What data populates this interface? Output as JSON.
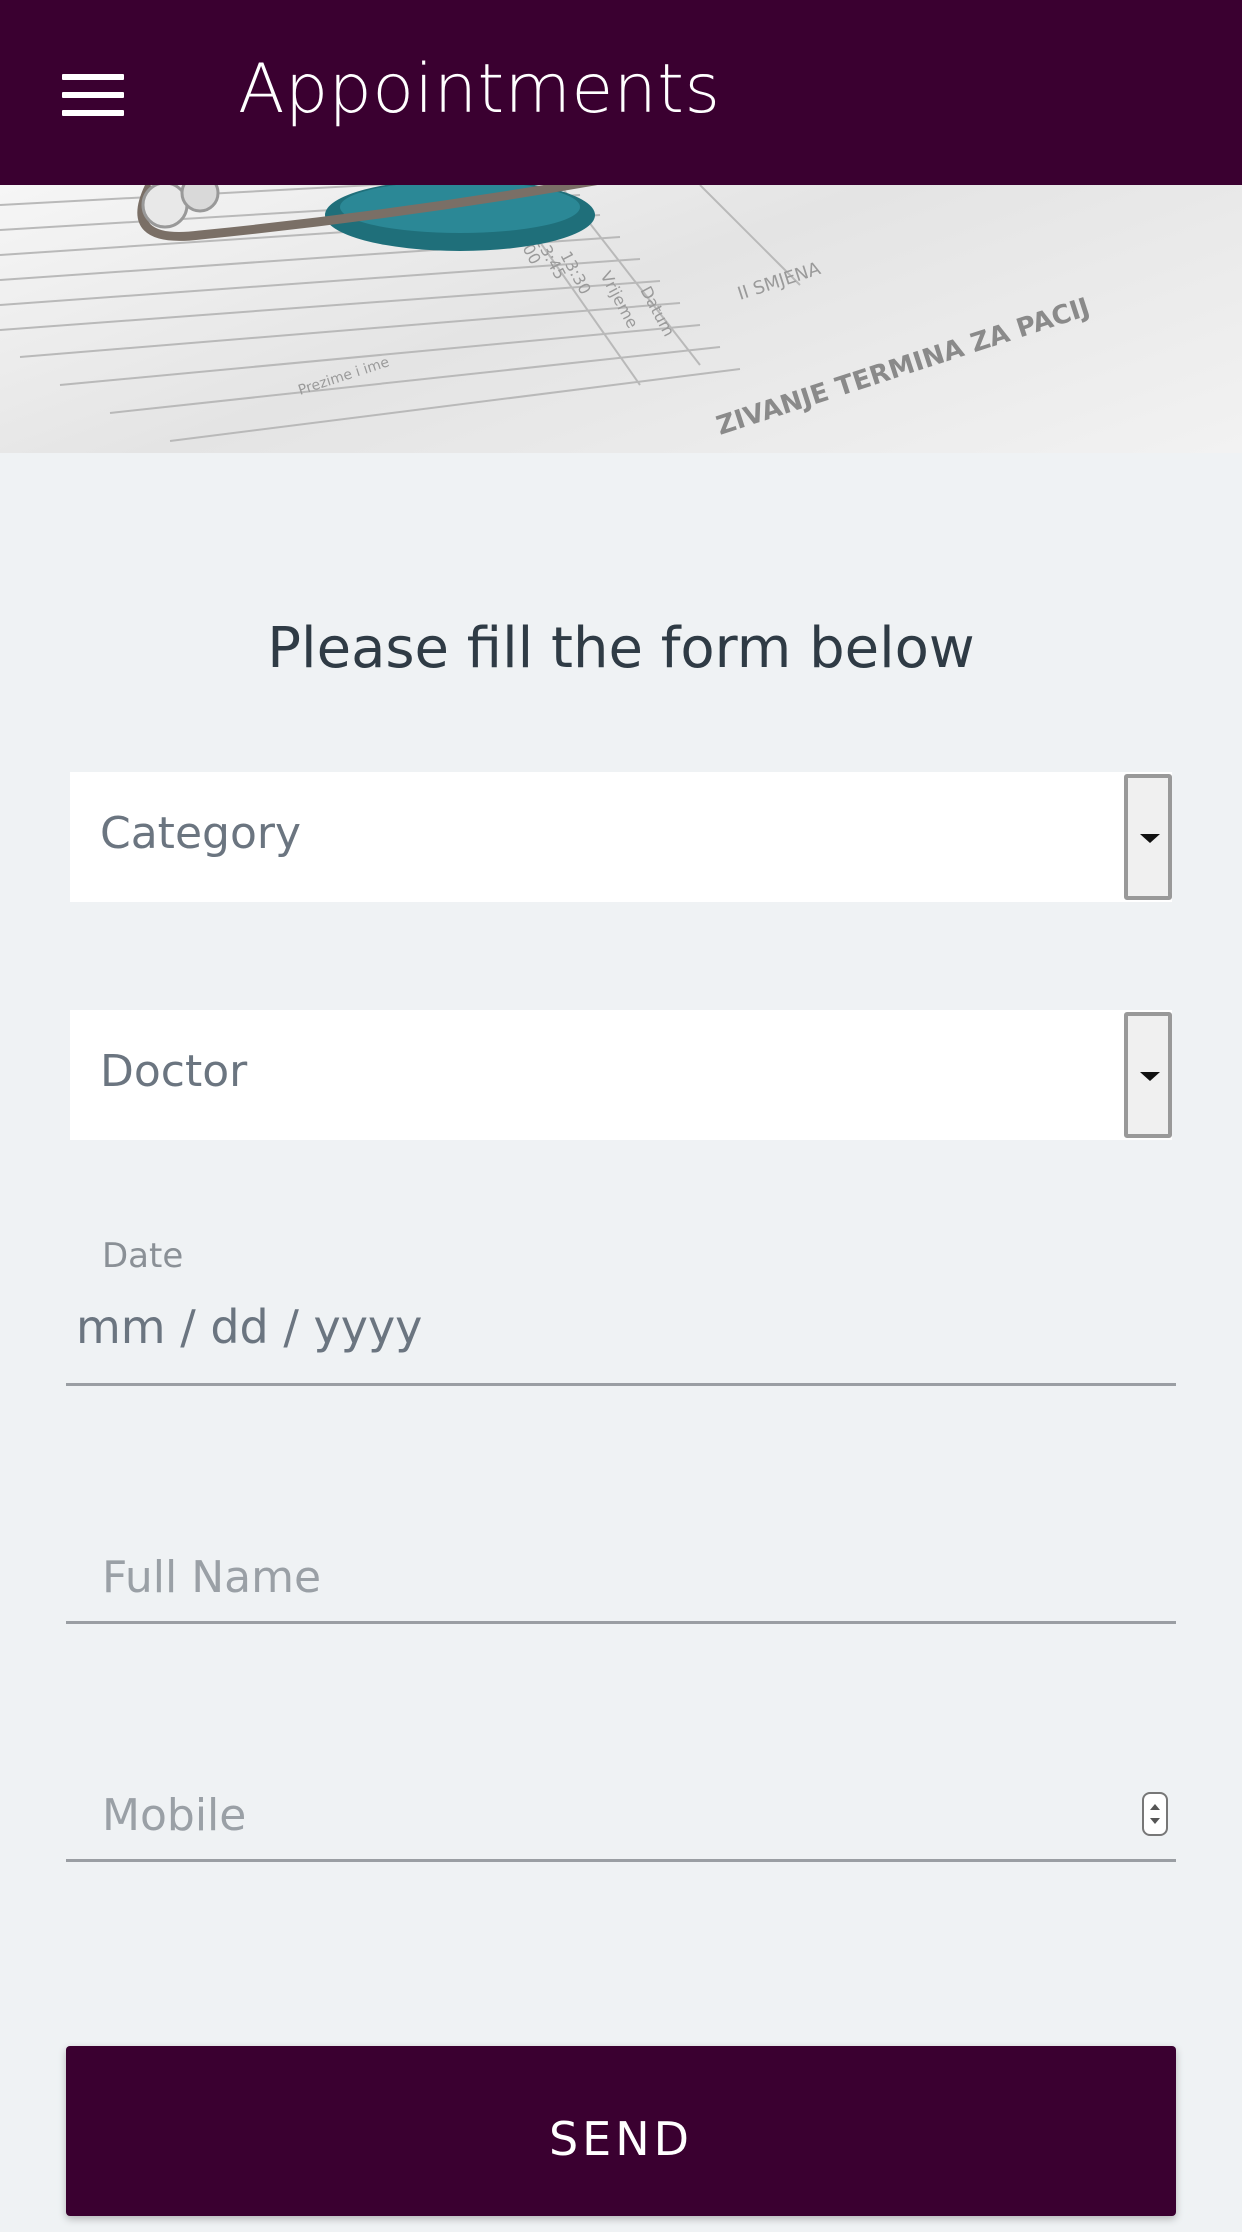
{
  "appbar": {
    "title": "Appointments",
    "menu_icon": "hamburger-menu-icon",
    "background_color": "#3a0030"
  },
  "hero": {
    "image": "stethoscope-on-appointment-form",
    "form_text_lines": [
      "ZIVANJE TERMINA ZA PACIJ",
      "II SMJENA",
      "Datum",
      "Vrijeme",
      "13:30",
      "13:45",
      "14:00",
      "Prezime i ime"
    ]
  },
  "form": {
    "heading": "Please fill the form below",
    "category": {
      "placeholder": "Category",
      "icon": "dropdown-arrow-icon"
    },
    "doctor": {
      "placeholder": "Doctor",
      "icon": "dropdown-arrow-icon"
    },
    "date": {
      "label": "Date",
      "value": "mm / dd / yyyy"
    },
    "full_name": {
      "placeholder": "Full Name"
    },
    "mobile": {
      "placeholder": "Mobile",
      "icon": "number-spinner-icon"
    },
    "send_label": "SEND"
  },
  "colors": {
    "accent": "#3a0030",
    "background": "#eff2f4"
  }
}
